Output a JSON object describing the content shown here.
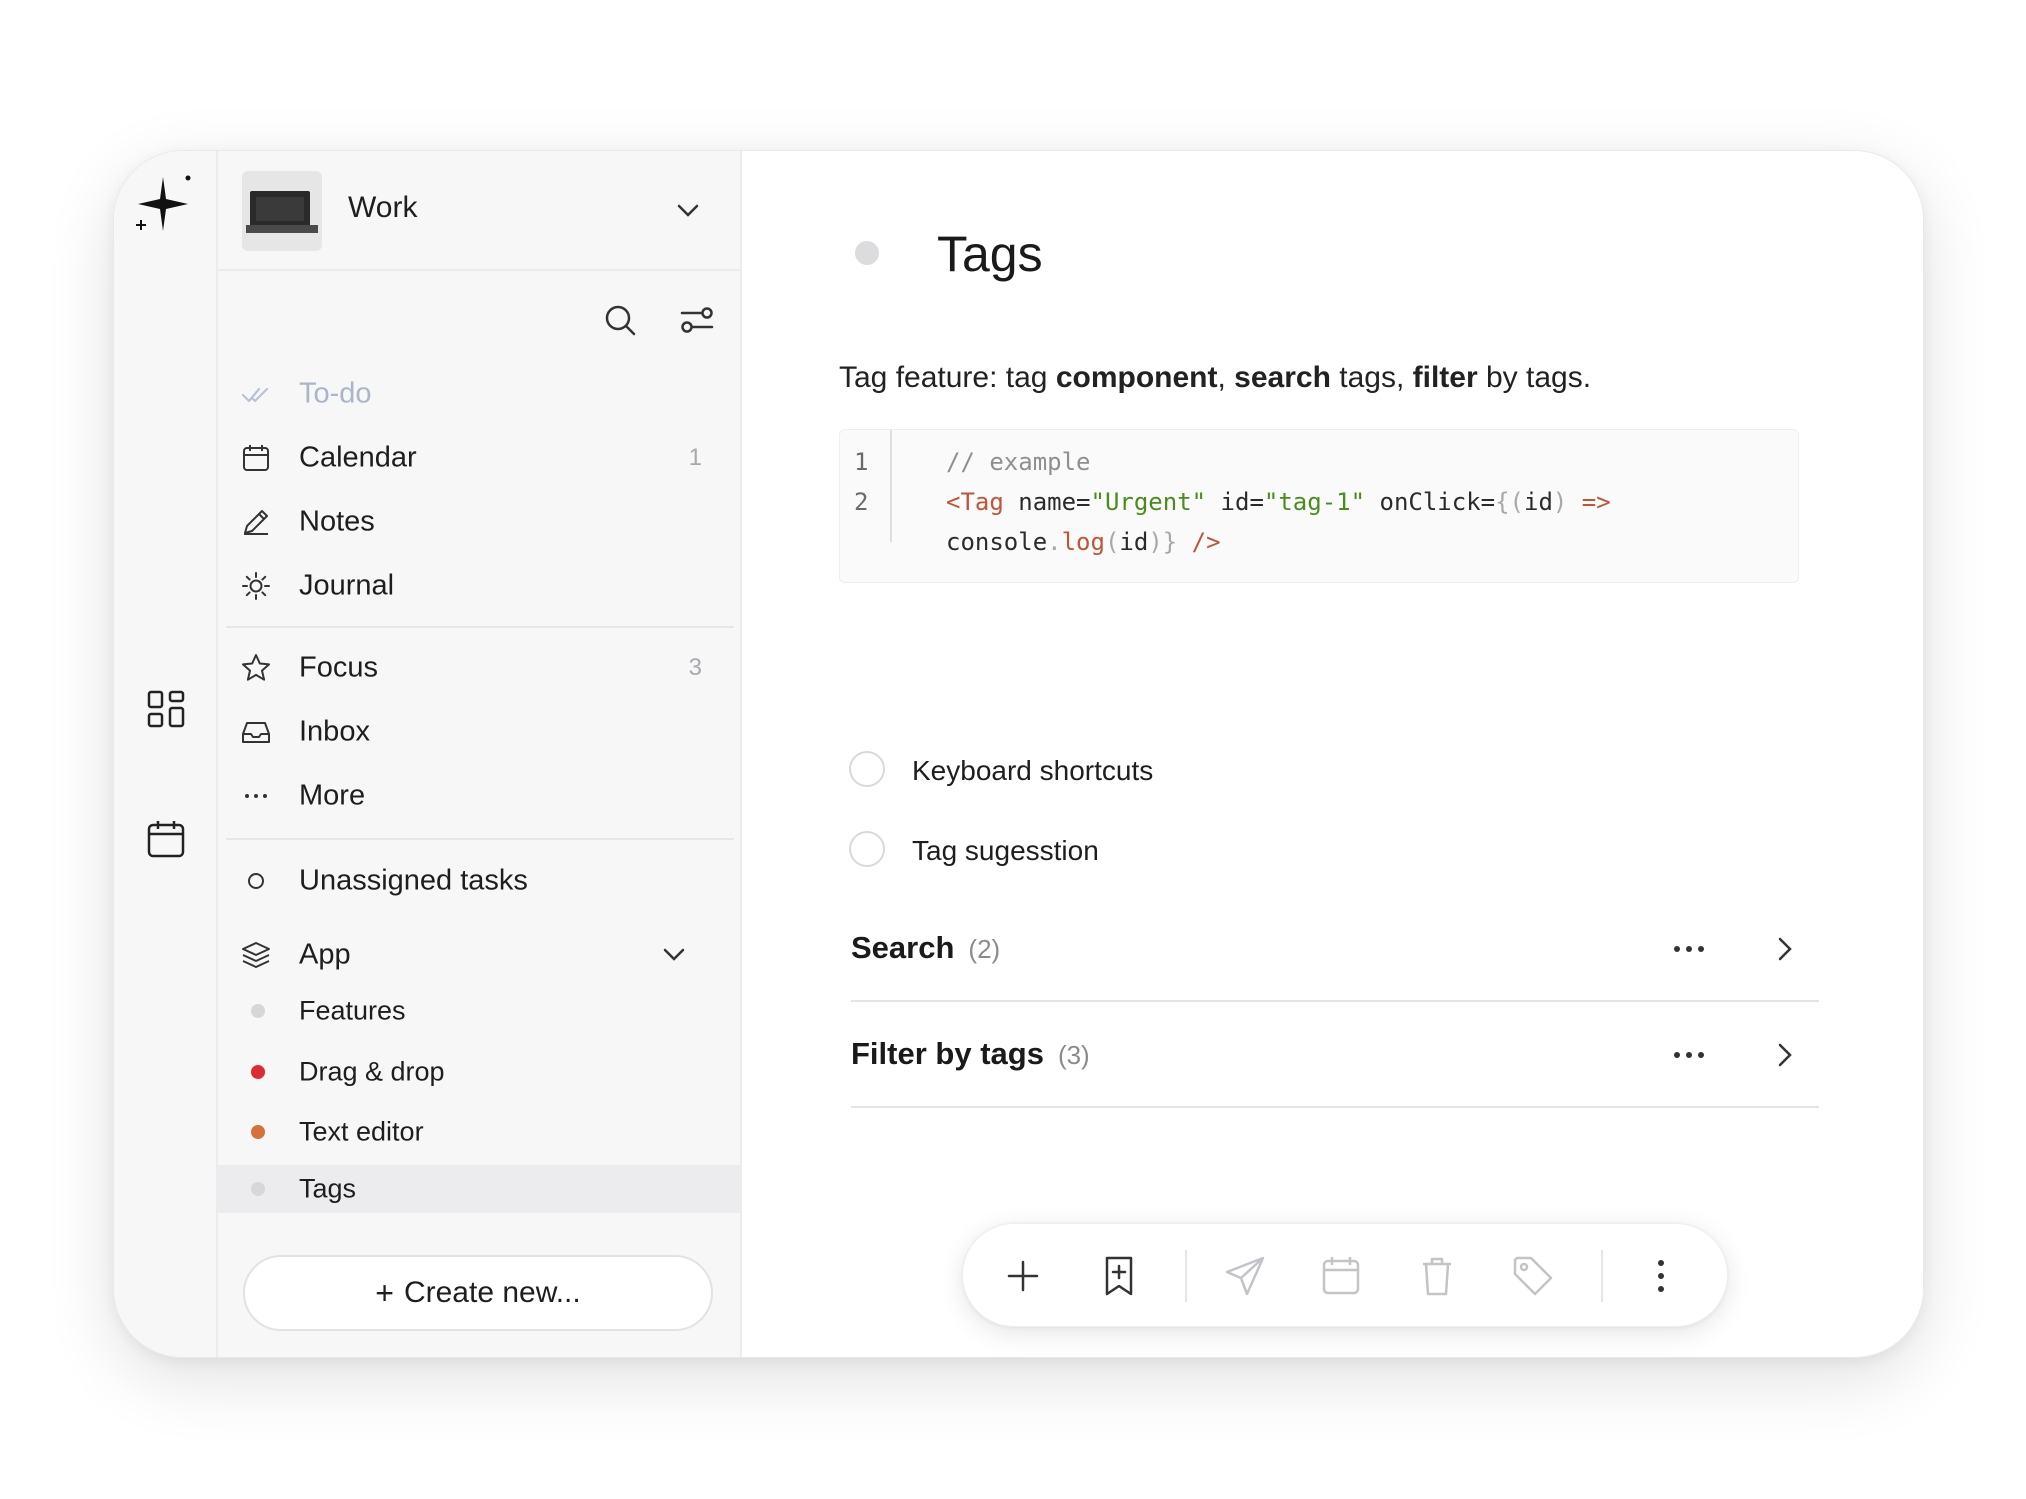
{
  "workspace": {
    "name": "Work"
  },
  "sidebar": {
    "primary": [
      {
        "label": "To-do",
        "icon": "double-check-icon",
        "count": "",
        "muted": true
      },
      {
        "label": "Calendar",
        "icon": "calendar-icon",
        "count": "1"
      },
      {
        "label": "Notes",
        "icon": "pencil-icon",
        "count": ""
      },
      {
        "label": "Journal",
        "icon": "sun-icon",
        "count": ""
      }
    ],
    "secondary": [
      {
        "label": "Focus",
        "icon": "star-icon",
        "count": "3"
      },
      {
        "label": "Inbox",
        "icon": "inbox-icon",
        "count": ""
      },
      {
        "label": "More",
        "icon": "ellipsis-icon",
        "count": ""
      }
    ],
    "unassigned": {
      "label": "Unassigned tasks",
      "icon": "circle-icon"
    },
    "project": {
      "label": "App",
      "icon": "layers-icon",
      "items": [
        {
          "label": "Features",
          "color": "#d7d7da"
        },
        {
          "label": "Drag & drop",
          "color": "#e02a33"
        },
        {
          "label": "Text editor",
          "color": "#d8703a"
        },
        {
          "label": "Tags",
          "color": "#d7d7da",
          "selected": true
        }
      ]
    },
    "create_label": "Create new..."
  },
  "main": {
    "title": "Tags",
    "description": {
      "p1": "Tag feature: tag ",
      "b1": "component",
      "p2": ", ",
      "b2": "search",
      "p3": " tags, ",
      "b3": "filter",
      "p4": " by tags."
    },
    "code": {
      "line_numbers": [
        "1",
        "2"
      ],
      "comment": "// example",
      "tag_open": "<Tag",
      "attr_name": " name=",
      "val_name": "\"Urgent\"",
      "attr_id": " id=",
      "val_id": "\"tag-1\"",
      "attr_onclick": " onClick=",
      "punc_open": "{(",
      "arg": "id",
      "punc_close": ")",
      "arrow": " =>",
      "console": "console",
      "dot": ".",
      "log": "log",
      "paren_open": "(",
      "arg2": "id",
      "paren_close": ")}",
      "self_close": " />"
    },
    "checklist": [
      {
        "label": "Keyboard shortcuts"
      },
      {
        "label": "Tag sugesstion"
      }
    ],
    "sections": [
      {
        "title": "Search",
        "count": "(2)"
      },
      {
        "title": "Filter by tags",
        "count": "(3)"
      }
    ]
  },
  "colors": {
    "accent_red": "#e02a33",
    "accent_orange": "#d8703a",
    "neutral_dot": "#d7d7da"
  }
}
